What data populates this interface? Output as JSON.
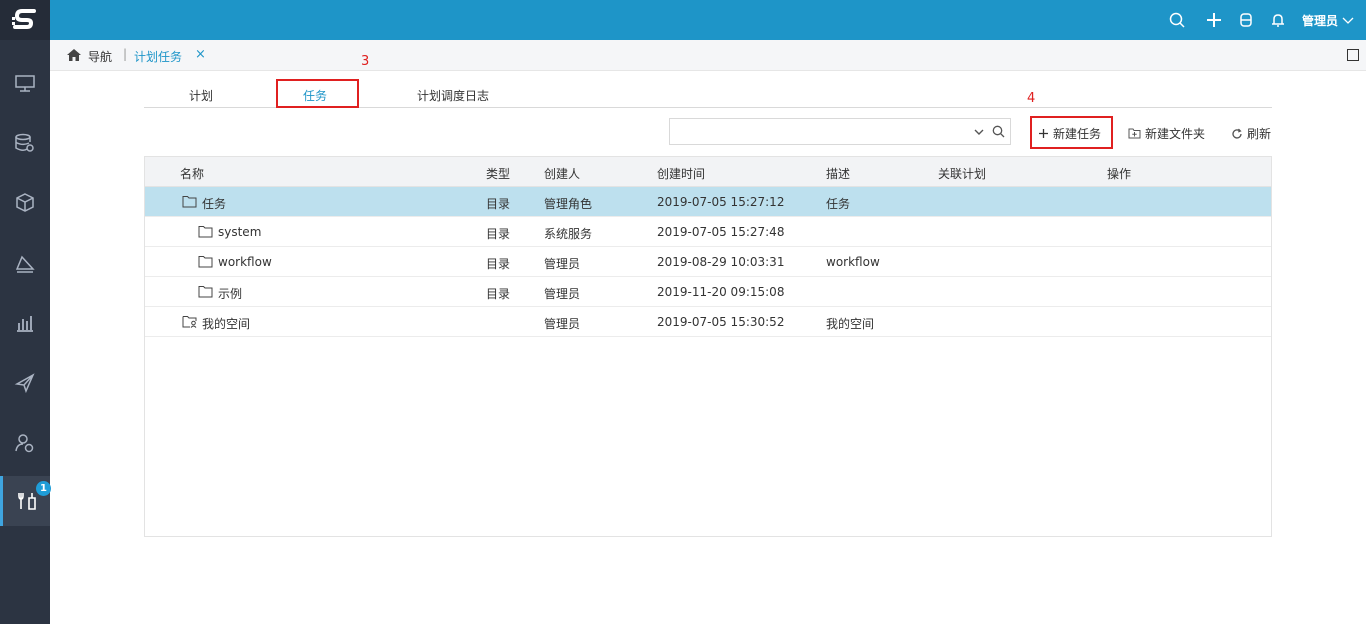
{
  "sidebar": {
    "logo": "s-logo",
    "items": [
      {
        "icon": "monitor-icon"
      },
      {
        "icon": "database-gear-icon"
      },
      {
        "icon": "cube-icon"
      },
      {
        "icon": "layers-icon"
      },
      {
        "icon": "bar-chart-icon"
      },
      {
        "icon": "paper-plane-icon"
      },
      {
        "icon": "user-settings-icon"
      },
      {
        "icon": "tools-icon",
        "badge": "1",
        "active": true
      }
    ]
  },
  "topbar": {
    "icons": [
      "search-icon",
      "plus-icon",
      "robot-icon",
      "bell-icon"
    ],
    "user": "管理员"
  },
  "breadcrumb": {
    "nav": "导航",
    "current_tab": "计划任务"
  },
  "annotations": {
    "step3": "3",
    "step4": "4"
  },
  "tabs": [
    {
      "label": "计划",
      "active": false
    },
    {
      "label": "任务",
      "active": true
    },
    {
      "label": "计划调度日志",
      "active": false
    }
  ],
  "toolbar": {
    "search_placeholder": "",
    "new_task": "新建任务",
    "new_folder": "新建文件夹",
    "refresh": "刷新"
  },
  "table": {
    "columns": [
      "名称",
      "类型",
      "创建人",
      "创建时间",
      "描述",
      "关联计划",
      "操作"
    ],
    "rows": [
      {
        "name": "任务",
        "type": "目录",
        "creator": "管理角色",
        "created": "2019-07-05 15:27:12",
        "desc": "任务",
        "plan": "",
        "ops": "",
        "level": 0,
        "icon": "folder-icon",
        "selected": true
      },
      {
        "name": "system",
        "type": "目录",
        "creator": "系统服务",
        "created": "2019-07-05 15:27:48",
        "desc": "",
        "plan": "",
        "ops": "",
        "level": 1,
        "icon": "folder-icon",
        "selected": false
      },
      {
        "name": "workflow",
        "type": "目录",
        "creator": "管理员",
        "created": "2019-08-29 10:03:31",
        "desc": "workflow",
        "plan": "",
        "ops": "",
        "level": 1,
        "icon": "folder-icon",
        "selected": false
      },
      {
        "name": "示例",
        "type": "目录",
        "creator": "管理员",
        "created": "2019-11-20 09:15:08",
        "desc": "",
        "plan": "",
        "ops": "",
        "level": 1,
        "icon": "folder-icon",
        "selected": false
      },
      {
        "name": "我的空间",
        "type": "",
        "creator": "管理员",
        "created": "2019-07-05 15:30:52",
        "desc": "我的空间",
        "plan": "",
        "ops": "",
        "level": 0,
        "icon": "user-folder-icon",
        "selected": false
      }
    ]
  },
  "colors": {
    "topbar": "#1e95c8",
    "sidebar": "#2c3442",
    "accent": "#1e95c8",
    "selected_row": "#bde0ee",
    "annotation": "#e02020"
  }
}
